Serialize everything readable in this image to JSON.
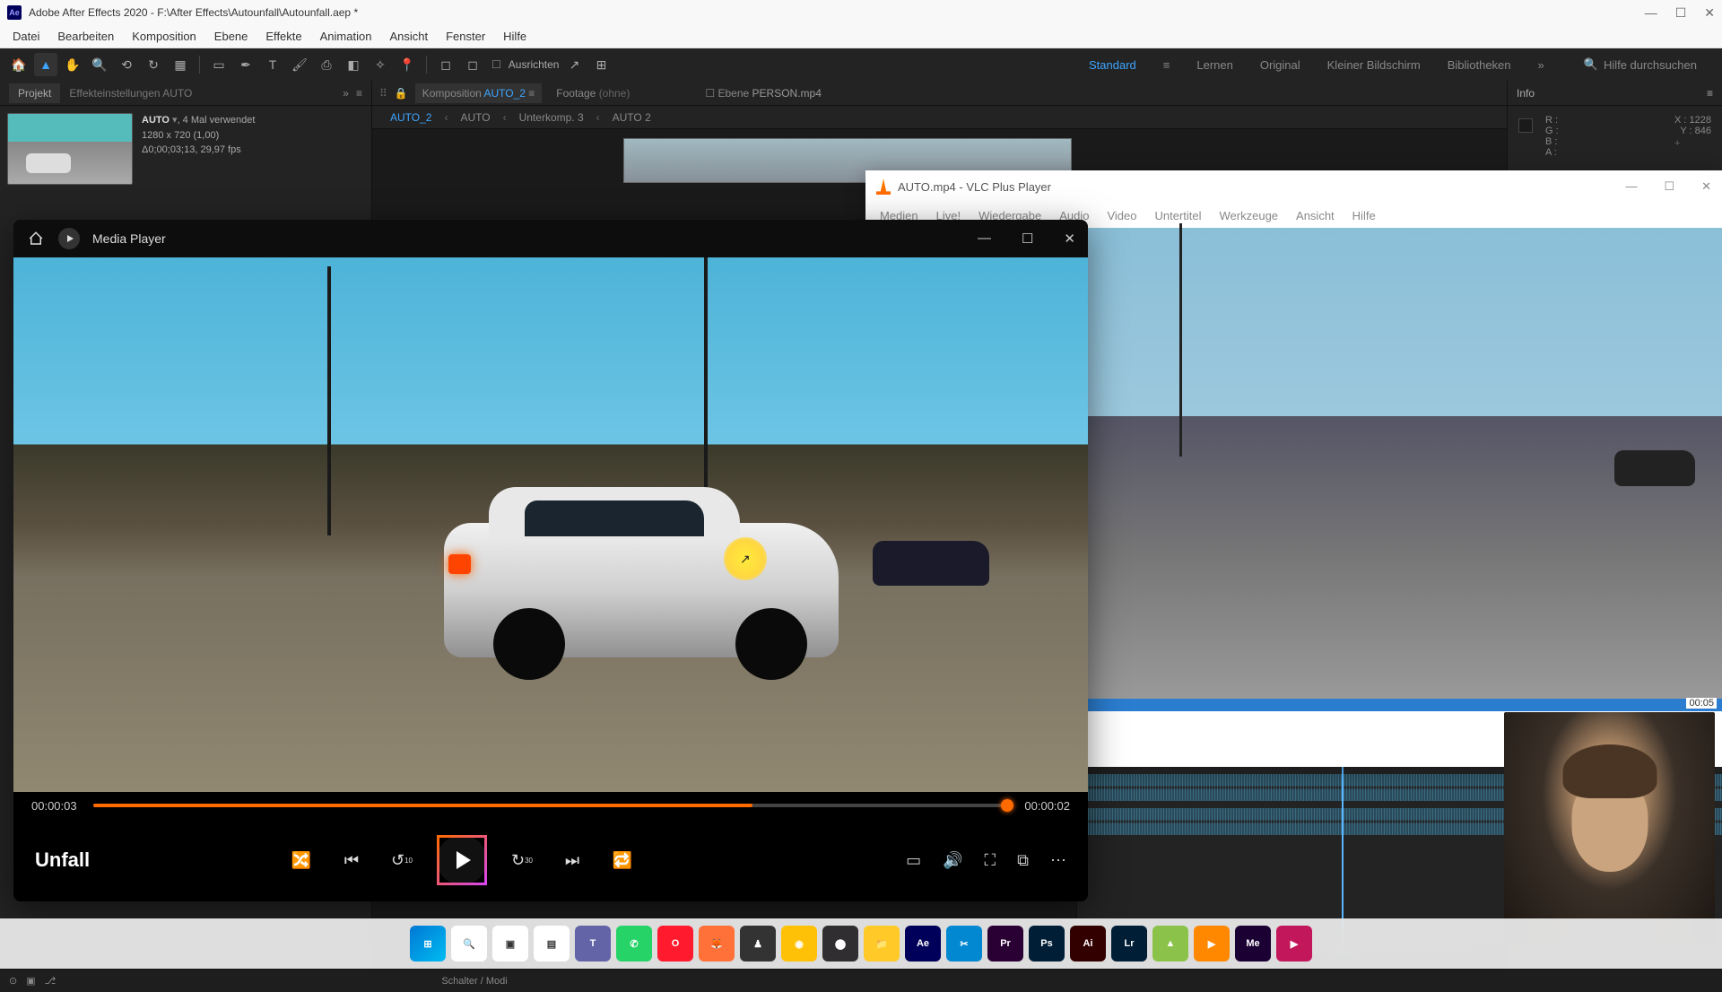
{
  "ae": {
    "title": "Adobe After Effects 2020 - F:\\After Effects\\Autounfall\\Autounfall.aep *",
    "menu": [
      "Datei",
      "Bearbeiten",
      "Komposition",
      "Ebene",
      "Effekte",
      "Animation",
      "Ansicht",
      "Fenster",
      "Hilfe"
    ],
    "workspaces": {
      "standard": "Standard",
      "lernen": "Lernen",
      "original": "Original",
      "klein": "Kleiner Bildschirm",
      "biblio": "Bibliotheken"
    },
    "search_placeholder": "Hilfe durchsuchen",
    "ausrichten": "Ausrichten",
    "project": {
      "tab_projekt": "Projekt",
      "tab_effekt": "Effekteinstellungen  AUTO",
      "item_name": "AUTO",
      "item_usage": ", 4 Mal verwendet",
      "item_res": "1280 x 720 (1,00)",
      "item_dur": "Δ0;00;03;13, 29,97 fps"
    },
    "comp": {
      "tab_comp": "Komposition",
      "tab_comp_name": "AUTO_2",
      "tab_footage": "Footage",
      "tab_footage_val": "(ohne)",
      "tab_ebene": "Ebene",
      "tab_ebene_val": "PERSON.mp4",
      "breadcrumb": [
        "AUTO_2",
        "AUTO",
        "Unterkomp. 3",
        "AUTO 2"
      ]
    },
    "info": {
      "title": "Info",
      "r": "R :",
      "g": "G :",
      "b": "B :",
      "a": "A :",
      "x": "X :",
      "xv": "1228",
      "y": "Y :",
      "yv": "846"
    },
    "schalter": "Schalter / Modi"
  },
  "vlc": {
    "title": "AUTO.mp4 - VLC Plus Player",
    "menu": [
      "Medien",
      "Live!",
      "Wiedergabe",
      "Audio",
      "Video",
      "Untertitel",
      "Werkzeuge",
      "Ansicht",
      "Hilfe"
    ],
    "time_total": "00:05"
  },
  "mp": {
    "title": "Media Player",
    "video_title": "Unfall",
    "time_elapsed": "00:00:03",
    "time_remaining": "00:00:02",
    "skip_back": "10",
    "skip_fwd": "30"
  },
  "taskbar": {
    "items": [
      {
        "name": "start",
        "bg": "linear-gradient(135deg,#0078d4,#00bcf2)",
        "txt": "⊞"
      },
      {
        "name": "search",
        "bg": "#fff",
        "txt": "🔍"
      },
      {
        "name": "taskview",
        "bg": "#fff",
        "txt": "▣"
      },
      {
        "name": "widgets",
        "bg": "#fff",
        "txt": "▤"
      },
      {
        "name": "teams",
        "bg": "#6264a7",
        "txt": "T"
      },
      {
        "name": "whatsapp",
        "bg": "#25d366",
        "txt": "✆"
      },
      {
        "name": "opera",
        "bg": "#ff1b2d",
        "txt": "O"
      },
      {
        "name": "firefox",
        "bg": "#ff7139",
        "txt": "🦊"
      },
      {
        "name": "app1",
        "bg": "#333",
        "txt": "♟"
      },
      {
        "name": "app2",
        "bg": "#ffc107",
        "txt": "◉"
      },
      {
        "name": "obs",
        "bg": "#302e31",
        "txt": "⬤"
      },
      {
        "name": "explorer",
        "bg": "#ffca28",
        "txt": "📁"
      },
      {
        "name": "ae",
        "bg": "#00005b",
        "txt": "Ae"
      },
      {
        "name": "app3",
        "bg": "#0288d1",
        "txt": "✂"
      },
      {
        "name": "premiere",
        "bg": "#2a0034",
        "txt": "Pr"
      },
      {
        "name": "photoshop",
        "bg": "#001e36",
        "txt": "Ps"
      },
      {
        "name": "illustrator",
        "bg": "#330000",
        "txt": "Ai"
      },
      {
        "name": "lightroom",
        "bg": "#001e36",
        "txt": "Lr"
      },
      {
        "name": "app4",
        "bg": "#8bc34a",
        "txt": "▲"
      },
      {
        "name": "vlc",
        "bg": "#ff8800",
        "txt": "▶"
      },
      {
        "name": "mediaencoder",
        "bg": "#1a0033",
        "txt": "Me"
      },
      {
        "name": "mediaplayer",
        "bg": "#c2185b",
        "txt": "▶"
      }
    ]
  }
}
